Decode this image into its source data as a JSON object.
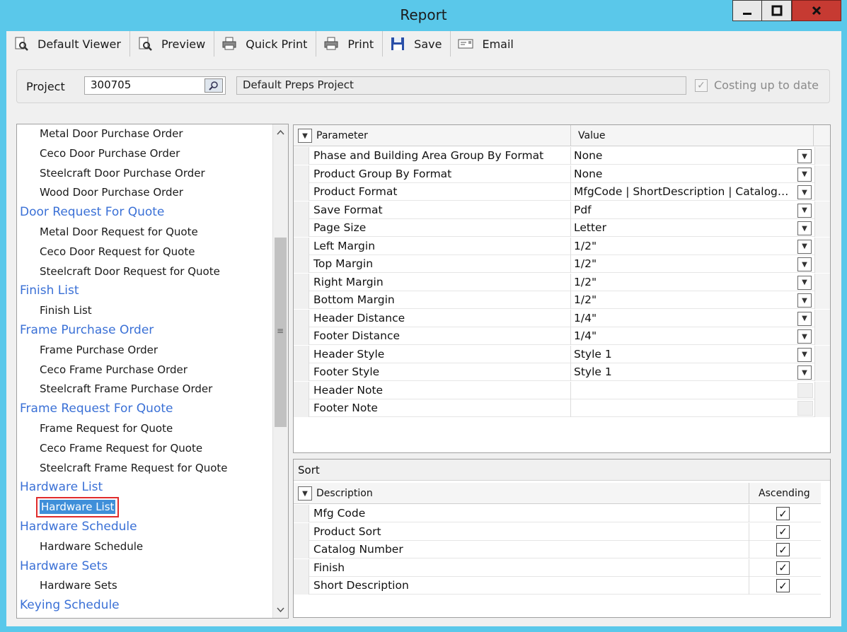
{
  "window": {
    "title": "Report"
  },
  "toolbar": {
    "default_viewer": "Default Viewer",
    "preview": "Preview",
    "quick_print": "Quick Print",
    "print": "Print",
    "save": "Save",
    "email": "Email"
  },
  "project": {
    "label": "Project",
    "number": "300705",
    "name": "Default Preps Project",
    "costing_label": "Costing up to date",
    "costing_checked": true
  },
  "reports": [
    {
      "label": "Metal Door Purchase Order",
      "kind": "item"
    },
    {
      "label": "Ceco Door Purchase Order",
      "kind": "item"
    },
    {
      "label": "Steelcraft Door Purchase Order",
      "kind": "item"
    },
    {
      "label": "Wood Door Purchase Order",
      "kind": "item"
    },
    {
      "label": "Door Request For Quote",
      "kind": "category"
    },
    {
      "label": "Metal Door Request for Quote",
      "kind": "item"
    },
    {
      "label": "Ceco Door Request for Quote",
      "kind": "item"
    },
    {
      "label": "Steelcraft Door Request for Quote",
      "kind": "item"
    },
    {
      "label": "Finish List",
      "kind": "category"
    },
    {
      "label": "Finish List",
      "kind": "item"
    },
    {
      "label": "Frame Purchase Order",
      "kind": "category"
    },
    {
      "label": "Frame Purchase Order",
      "kind": "item"
    },
    {
      "label": "Ceco Frame Purchase Order",
      "kind": "item"
    },
    {
      "label": "Steelcraft Frame Purchase Order",
      "kind": "item"
    },
    {
      "label": "Frame Request For Quote",
      "kind": "category"
    },
    {
      "label": "Frame Request for Quote",
      "kind": "item"
    },
    {
      "label": "Ceco Frame Request for Quote",
      "kind": "item"
    },
    {
      "label": "Steelcraft Frame Request for Quote",
      "kind": "item"
    },
    {
      "label": "Hardware List",
      "kind": "category"
    },
    {
      "label": "Hardware List",
      "kind": "selected"
    },
    {
      "label": "Hardware Schedule",
      "kind": "category"
    },
    {
      "label": "Hardware Schedule",
      "kind": "item"
    },
    {
      "label": "Hardware Sets",
      "kind": "category"
    },
    {
      "label": "Hardware Sets",
      "kind": "item"
    },
    {
      "label": "Keying Schedule",
      "kind": "category"
    }
  ],
  "parameters": {
    "col_parameter": "Parameter",
    "col_value": "Value",
    "rows": [
      {
        "parameter": "Phase and Building Area Group By Format",
        "value": "None",
        "dropdown": true
      },
      {
        "parameter": "Product Group By Format",
        "value": "None",
        "dropdown": true
      },
      {
        "parameter": "Product Format",
        "value": "MfgCode | ShortDescription | CatalogNumber",
        "dropdown": true
      },
      {
        "parameter": "Save Format",
        "value": "Pdf",
        "dropdown": true
      },
      {
        "parameter": "Page Size",
        "value": "Letter",
        "dropdown": true
      },
      {
        "parameter": "Left Margin",
        "value": "1/2\"",
        "dropdown": true
      },
      {
        "parameter": "Top Margin",
        "value": "1/2\"",
        "dropdown": true
      },
      {
        "parameter": "Right Margin",
        "value": "1/2\"",
        "dropdown": true
      },
      {
        "parameter": "Bottom Margin",
        "value": "1/2\"",
        "dropdown": true
      },
      {
        "parameter": "Header Distance",
        "value": "1/4\"",
        "dropdown": true
      },
      {
        "parameter": "Footer Distance",
        "value": "1/4\"",
        "dropdown": true
      },
      {
        "parameter": "Header Style",
        "value": "Style 1",
        "dropdown": true
      },
      {
        "parameter": "Footer Style",
        "value": "Style 1",
        "dropdown": true
      },
      {
        "parameter": "Header Note",
        "value": "",
        "dropdown": false
      },
      {
        "parameter": "Footer Note",
        "value": "",
        "dropdown": false
      }
    ]
  },
  "sort": {
    "title": "Sort",
    "col_description": "Description",
    "col_ascending": "Ascending",
    "rows": [
      {
        "description": "Mfg Code",
        "ascending": true
      },
      {
        "description": "Product Sort",
        "ascending": true
      },
      {
        "description": "Catalog Number",
        "ascending": true
      },
      {
        "description": "Finish",
        "ascending": true
      },
      {
        "description": "Short Description",
        "ascending": true
      }
    ]
  }
}
